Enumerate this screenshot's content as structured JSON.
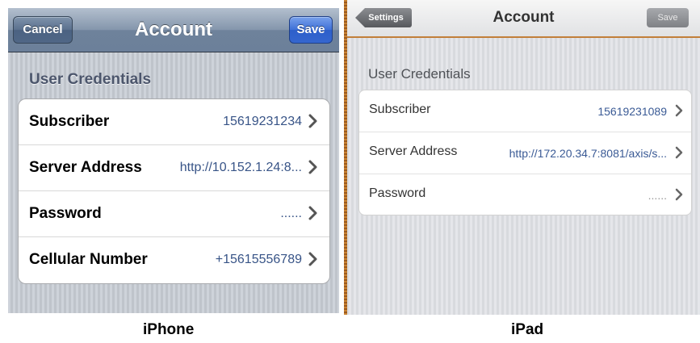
{
  "iphone": {
    "nav": {
      "cancel_label": "Cancel",
      "title": "Account",
      "save_label": "Save"
    },
    "section_header": "User Credentials",
    "rows": [
      {
        "label": "Subscriber",
        "value": "15619231234"
      },
      {
        "label": "Server Address",
        "value": "http://10.152.1.24:8..."
      },
      {
        "label": "Password",
        "value": "......"
      },
      {
        "label": "Cellular Number",
        "value": "+15615556789"
      }
    ],
    "caption": "iPhone"
  },
  "ipad": {
    "nav": {
      "back_label": "Settings",
      "title": "Account",
      "save_label": "Save"
    },
    "section_header": "User Credentials",
    "rows": [
      {
        "label": "Subscriber",
        "value": "15619231089"
      },
      {
        "label": "Server Address",
        "value": "http://172.20.34.7:8081/axis/s..."
      },
      {
        "label": "Password",
        "value": "......"
      }
    ],
    "caption": "iPad"
  },
  "colors": {
    "iphone_nav": "#6e829b",
    "iphone_save": "#3566cf",
    "value_text": "#385487",
    "ipad_frame": "#c27f3a"
  },
  "icons": {
    "row_disclosure": "chevron-right-icon"
  }
}
